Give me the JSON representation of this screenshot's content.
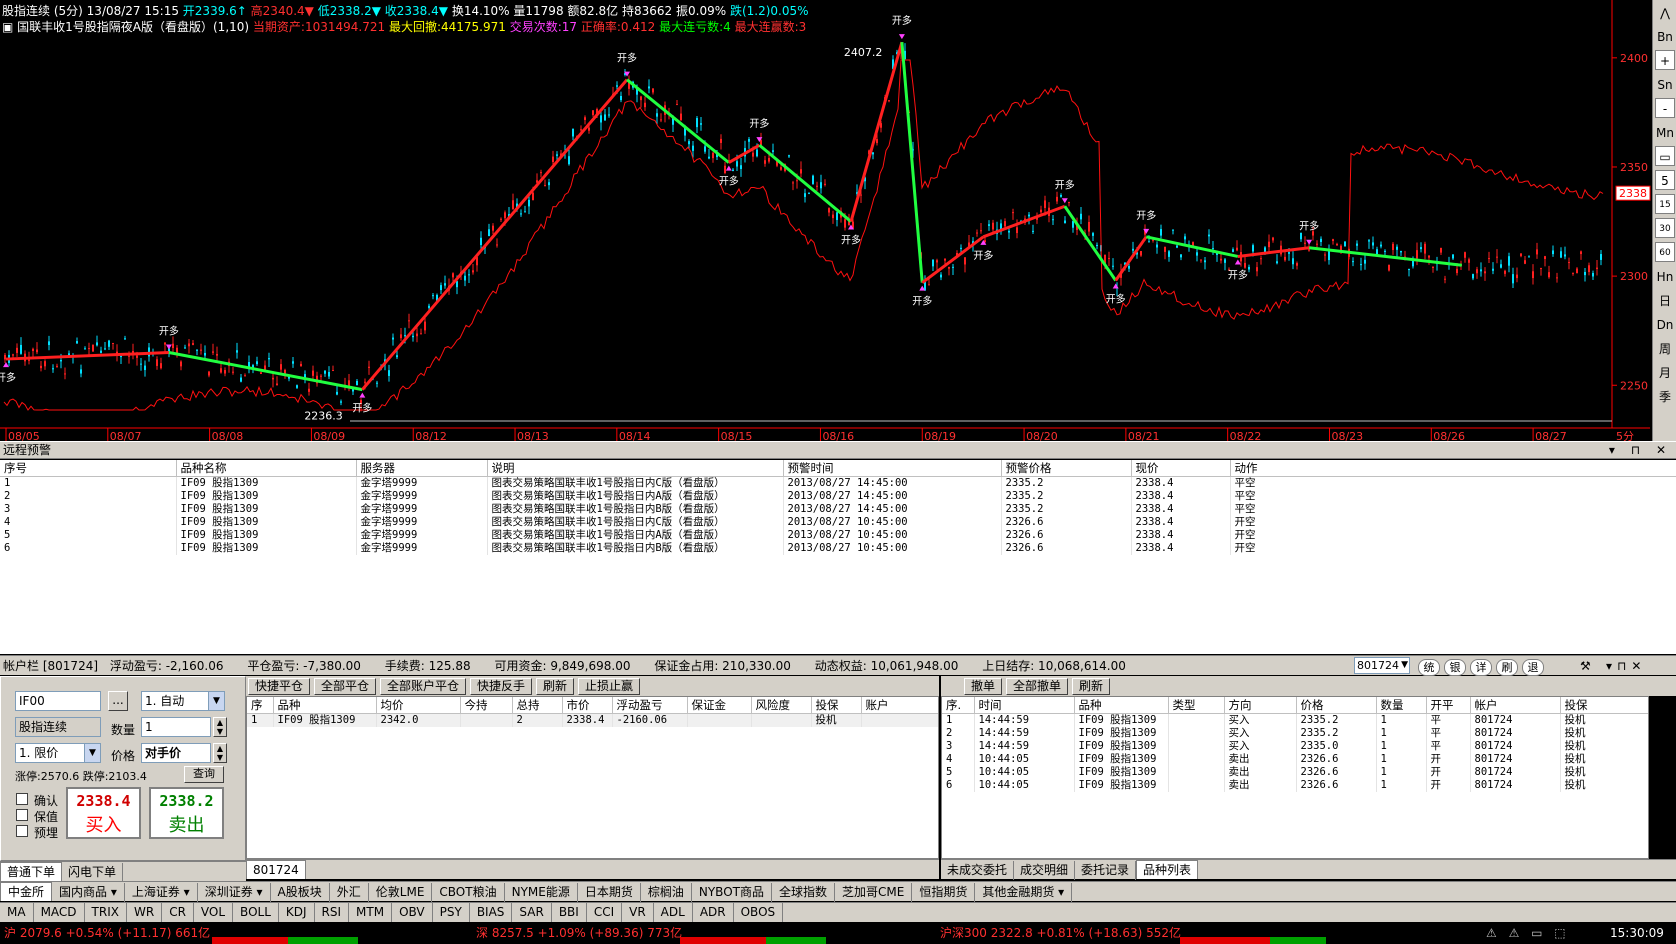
{
  "chart": {
    "header1": {
      "title": "股指连续",
      "period": "(5分)",
      "datetime": "13/08/27 15:15",
      "open": "开2339.6↑",
      "high": "高2340.4▼",
      "low": "低2338.2▼",
      "close": "收2338.4▼",
      "turnover": "换14.10%",
      "volume": "量11798",
      "amount": "额82.8亿",
      "hold": "持83662",
      "amp": "振0.09%",
      "change": "跌(1.2)0.05%"
    },
    "header2": {
      "strategy": "▣ 国联丰收1号股指隔夜A版（看盘版）(1,10)",
      "assets": "当期资产:1031494.721",
      "max_drawdown": "最大回撤:44175.971",
      "trades": "交易次数:17",
      "win_rate": "正确率:0.412",
      "max_wins": "最大连亏数:4",
      "max_losses": "最大连赢数:3"
    },
    "price_labels": [
      "2400",
      "2350",
      "2300",
      "2250"
    ],
    "current_price": "2338",
    "x_labels": [
      "08/05",
      "08/07",
      "08/08",
      "08/09",
      "08/12",
      "08/13",
      "08/14",
      "08/15",
      "08/16",
      "08/19",
      "08/20",
      "08/21",
      "08/22",
      "08/23",
      "08/26",
      "08/27"
    ],
    "period_label": "5分",
    "annot_high": "2407.2",
    "annot_low": "2236.3",
    "signal_text": "开多",
    "colors": {
      "up": "#ff2020",
      "down": "#00e0ff",
      "long": "#ff2020",
      "short": "#20ff40",
      "equity": "#ff1010",
      "axis": "#ff0000"
    }
  },
  "chart_data": {
    "type": "line",
    "title": "股指连续 (5分)",
    "x": [
      "08/05",
      "08/07",
      "08/08",
      "08/09",
      "08/12",
      "08/13",
      "08/14",
      "08/15",
      "08/16",
      "08/19",
      "08/20",
      "08/21",
      "08/22",
      "08/23",
      "08/26",
      "08/27"
    ],
    "ylim": [
      2235,
      2410
    ],
    "series": [
      {
        "name": "trade_line",
        "points": [
          [
            0,
            2262
          ],
          [
            1.6,
            2265
          ],
          [
            3.5,
            2248
          ],
          [
            6.1,
            2390
          ],
          [
            7.1,
            2352
          ],
          [
            7.4,
            2360
          ],
          [
            8.3,
            2325
          ],
          [
            8.8,
            2407.2
          ],
          [
            9,
            2297
          ],
          [
            9.6,
            2318
          ],
          [
            10.4,
            2332
          ],
          [
            10.9,
            2298
          ],
          [
            11.2,
            2318
          ],
          [
            12.1,
            2309
          ],
          [
            12.8,
            2313
          ],
          [
            14.3,
            2305
          ]
        ]
      }
    ]
  },
  "right_toolbar": [
    "⋀",
    "Bn",
    "+",
    "Sn",
    "-",
    "Mn",
    "▭",
    "5",
    "15",
    "30",
    "60",
    "Hn",
    "日",
    "Dn",
    "周",
    "月",
    "季"
  ],
  "alerts_panel": {
    "title": "远程预警",
    "columns": [
      "序号",
      "品种名称",
      "服务器",
      "说明",
      "预警时间",
      "预警价格",
      "现价",
      "动作"
    ],
    "rows": [
      [
        "1",
        "IF09 股指1309",
        "金字塔9999",
        "图表交易策略国联丰收1号股指日内C版（看盘版）",
        "2013/08/27 14:45:00",
        "2335.2",
        "2338.4",
        "平空"
      ],
      [
        "2",
        "IF09 股指1309",
        "金字塔9999",
        "图表交易策略国联丰收1号股指日内A版（看盘版）",
        "2013/08/27 14:45:00",
        "2335.2",
        "2338.4",
        "平空"
      ],
      [
        "3",
        "IF09 股指1309",
        "金字塔9999",
        "图表交易策略国联丰收1号股指日内B版（看盘版）",
        "2013/08/27 14:45:00",
        "2335.2",
        "2338.4",
        "平空"
      ],
      [
        "4",
        "IF09 股指1309",
        "金字塔9999",
        "图表交易策略国联丰收1号股指日内C版（看盘版）",
        "2013/08/27 10:45:00",
        "2326.6",
        "2338.4",
        "开空"
      ],
      [
        "5",
        "IF09 股指1309",
        "金字塔9999",
        "图表交易策略国联丰收1号股指日内A版（看盘版）",
        "2013/08/27 10:45:00",
        "2326.6",
        "2338.4",
        "开空"
      ],
      [
        "6",
        "IF09 股指1309",
        "金字塔9999",
        "图表交易策略国联丰收1号股指日内B版（看盘版）",
        "2013/08/27 10:45:00",
        "2326.6",
        "2338.4",
        "开空"
      ]
    ]
  },
  "account_bar": {
    "label": "帐户栏",
    "account": "[801724]",
    "float_pl": "浮动盈亏: -2,160.06",
    "close_pl": "平仓盈亏: -7,380.00",
    "fee": "手续费: 125.88",
    "available": "可用资金: 9,849,698.00",
    "margin": "保证金占用: 210,330.00",
    "equity": "动态权益: 10,061,948.00",
    "prev": "上日结存: 10,068,614.00",
    "account_select": "801724",
    "buttons": [
      "统",
      "银",
      "详",
      "刷",
      "退"
    ]
  },
  "order_entry": {
    "code": "IF00",
    "dots": "...",
    "mode": "1. 自动",
    "name": "股指连续",
    "qty_label": "数量",
    "qty": "1",
    "price_type": "1. 限价",
    "price_label": "价格",
    "price": "对手价",
    "limit_text": "涨停:2570.6 跌停:2103.4",
    "query": "查询",
    "confirm": "确认",
    "hedge": "保值",
    "preset": "预埋",
    "buy_price": "2338.4",
    "buy_label": "买入",
    "sell_price": "2338.2",
    "sell_label": "卖出",
    "tabs": [
      "普通下单",
      "闪电下单"
    ]
  },
  "positions": {
    "buttons": [
      "快捷平仓",
      "全部平仓",
      "全部账户平仓",
      "快捷反手",
      "刷新",
      "止损止赢"
    ],
    "columns": [
      "序",
      "品种",
      "均价",
      "今持",
      "总持",
      "市价",
      "浮动盈亏",
      "保证金",
      "风险度",
      "投保",
      "账户"
    ],
    "rows": [
      [
        "1",
        "IF09 股指1309",
        "2342.0",
        "",
        "2",
        "2338.4",
        "-2160.06",
        "",
        "",
        "投机",
        ""
      ]
    ],
    "tab": "801724"
  },
  "orders": {
    "buttons": [
      "撤单",
      "全部撤单",
      "刷新"
    ],
    "columns": [
      "序.",
      "时间",
      "品种",
      "类型",
      "方向",
      "价格",
      "数量",
      "开平",
      "帐户",
      "投保"
    ],
    "rows": [
      [
        "1",
        "14:44:59",
        "IF09 股指1309",
        "",
        "买入",
        "2335.2",
        "1",
        "平",
        "801724",
        "投机"
      ],
      [
        "2",
        "14:44:59",
        "IF09 股指1309",
        "",
        "买入",
        "2335.2",
        "1",
        "平",
        "801724",
        "投机"
      ],
      [
        "3",
        "14:44:59",
        "IF09 股指1309",
        "",
        "买入",
        "2335.0",
        "1",
        "平",
        "801724",
        "投机"
      ],
      [
        "4",
        "10:44:05",
        "IF09 股指1309",
        "",
        "卖出",
        "2326.6",
        "1",
        "开",
        "801724",
        "投机"
      ],
      [
        "5",
        "10:44:05",
        "IF09 股指1309",
        "",
        "卖出",
        "2326.6",
        "1",
        "开",
        "801724",
        "投机"
      ],
      [
        "6",
        "10:44:05",
        "IF09 股指1309",
        "",
        "卖出",
        "2326.6",
        "1",
        "开",
        "801724",
        "投机"
      ]
    ],
    "tabs": [
      "未成交委托",
      "成交明细",
      "委托记录",
      "品种列表"
    ]
  },
  "market_tabs": [
    "中金所",
    "国内商品 ▾",
    "上海证券 ▾",
    "深圳证券 ▾",
    "A股板块",
    "外汇",
    "伦敦LME",
    "CBOT粮油",
    "NYME能源",
    "日本期货",
    "棕榈油",
    "NYBOT商品",
    "全球指数",
    "芝加哥CME",
    "恒指期货",
    "其他金融期货 ▾"
  ],
  "indicator_tabs": [
    "MA",
    "MACD",
    "TRIX",
    "WR",
    "CR",
    "VOL",
    "BOLL",
    "KDJ",
    "RSI",
    "MTM",
    "OBV",
    "PSY",
    "BIAS",
    "SAR",
    "BBI",
    "CCI",
    "VR",
    "ADL",
    "ADR",
    "OBOS"
  ],
  "status": {
    "sh": "沪 2079.6 +0.54% (+11.17) 661亿",
    "sz": "深 8257.5 +1.09% (+89.36) 773亿",
    "hs300": "沪深300  2322.8 +0.81% (+18.63) 552亿",
    "time": "15:30:09"
  }
}
